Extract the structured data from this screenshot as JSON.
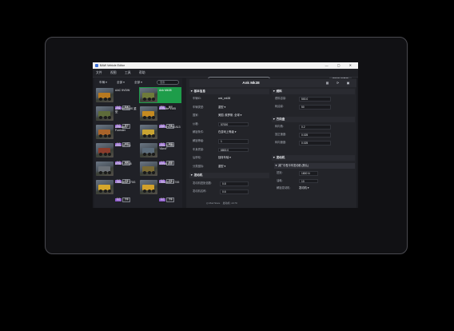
{
  "window": {
    "title": "BAW Vehicle Editor",
    "controls": "— ▢ ✕"
  },
  "menu": [
    "文件",
    "视图",
    "工具",
    "帮助"
  ],
  "topbar": {
    "search_value": "SnowRunner",
    "right_button": "移除所选载具"
  },
  "filters": {
    "sort": "车辆",
    "f2": "全部",
    "f3": "全部",
    "search_placeholder": "搜索"
  },
  "vehicles": [
    {
      "name": "AAC 5VDW",
      "tags": [
        "自定",
        "基本"
      ],
      "color": "#b7791f",
      "selected": false
    },
    {
      "name": "Ank Mk38",
      "tags": [
        "原版",
        "重型"
      ],
      "color": "#6f7b3a",
      "selected": true
    },
    {
      "name": "ANK MK38HS 重型",
      "tags": [
        "自定",
        "重型"
      ],
      "color": "#5e6b3a",
      "selected": false
    },
    {
      "name": "Ankalite 1185",
      "tags": [
        "自定",
        "卡车"
      ],
      "color": "#c58b21",
      "selected": false
    },
    {
      "name": "Aramatec Forester",
      "tags": [
        "自定",
        "车辆"
      ],
      "color": "#a8632a",
      "selected": false
    },
    {
      "name": "AVENHORN A13",
      "tags": [
        "自定",
        "车辆"
      ],
      "color": "#c9a432",
      "selected": false
    },
    {
      "name": "Azov 4S 101",
      "tags": [
        "自定",
        "车辆"
      ],
      "color": "#8a3c2c",
      "selected": false
    },
    {
      "name": "Azov 67080 “Akrol”",
      "tags": [
        "自定",
        "车辆"
      ],
      "color": "#5b6b7a",
      "selected": false
    },
    {
      "name": "BOAR 45318",
      "tags": [
        "自定",
        "卡车"
      ],
      "color": "#6c7178",
      "selected": false
    },
    {
      "name": "Burlak 8x8",
      "tags": [
        "自定",
        "卡车"
      ],
      "color": "#7a6a34",
      "selected": false
    },
    {
      "name": "Caterpillar 770G",
      "tags": [
        "自定",
        "卡车"
      ],
      "color": "#d5a72c",
      "selected": false
    },
    {
      "name": "Caterpillar C745",
      "tags": [
        "自定",
        "卡车"
      ],
      "color": "#d2a12b",
      "selected": false
    }
  ],
  "detail": {
    "title": "Ank Mk38",
    "icons": [
      "grid-icon",
      "refresh-icon",
      "save-icon"
    ],
    "basic": {
      "heading": "基本信息",
      "rows": [
        {
          "label": "车辆ID:",
          "value": "ank_mk38"
        },
        {
          "label": "车辆类型:",
          "value": "重型"
        },
        {
          "label": "国家:",
          "value": "美国, 俄罗斯, 全球"
        },
        {
          "label": "价格:",
          "value": "57000"
        },
        {
          "label": "解锁条件:",
          "value": "在游戏上等级"
        },
        {
          "label": "解锁等级:",
          "value": "1"
        },
        {
          "label": "车身质量:",
          "value": "6800.0"
        },
        {
          "label": "后桥轮:",
          "value": "独特车轴"
        },
        {
          "label": "分类图标:",
          "value": "重型"
        }
      ]
    },
    "engine_sect": {
      "heading": "发动机",
      "rows": [
        {
          "label": "发动机扭矩倍数:",
          "value": "0.8"
        },
        {
          "label": "发动机名称:",
          "value": "0.6"
        }
      ]
    },
    "fuel": {
      "heading": "燃料",
      "rows": [
        {
          "label": "燃料容量:",
          "value": "500.0"
        },
        {
          "label": "耗油量:",
          "value": "50"
        }
      ]
    },
    "steering": {
      "heading": "方向盘",
      "rows": [
        {
          "label": "转向角:",
          "value": "0.2"
        },
        {
          "label": "回正速度:",
          "value": "0.025"
        },
        {
          "label": "转向速度:",
          "value": "0.025"
        }
      ]
    },
    "engine_group": {
      "heading": "发动机",
      "sub": "减广中型卡车发动机 (默认)",
      "rows": [
        {
          "label": "扭矩:",
          "value": "1800 N"
        },
        {
          "label": "油耗:",
          "value": "10"
        },
        {
          "label": "解锁发动机:",
          "value": "发动机"
        }
      ]
    }
  },
  "statusbar": {
    "left": "◎ Mod Store",
    "right": "发动机: v0.70"
  }
}
